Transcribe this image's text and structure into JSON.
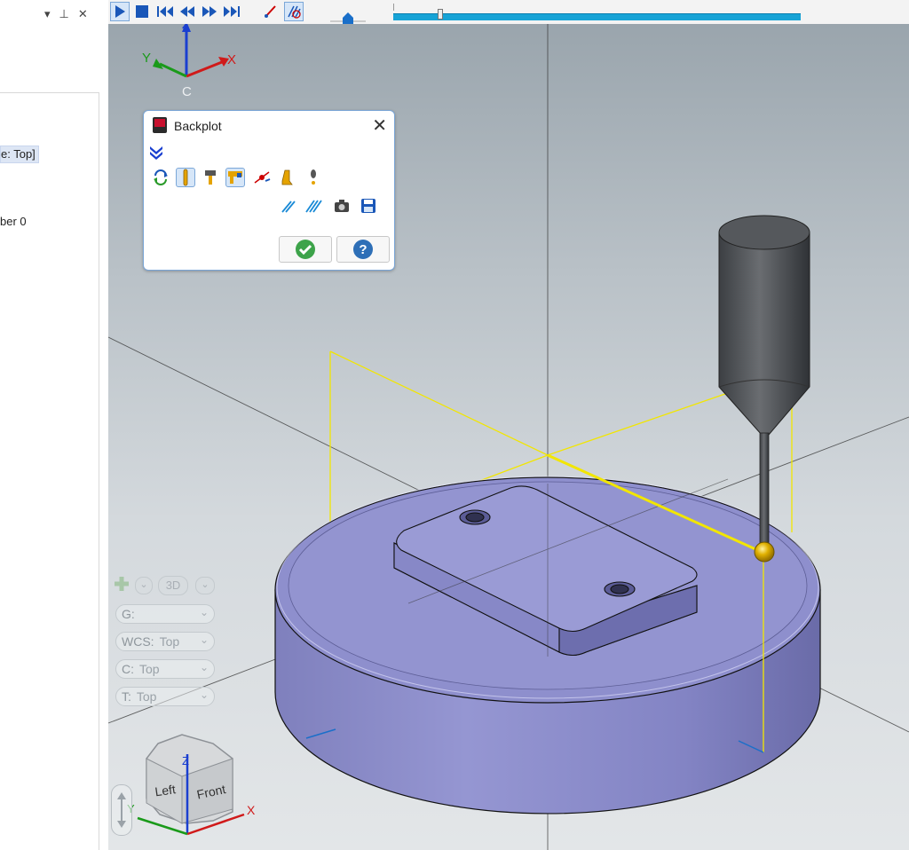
{
  "left_panel": {
    "tree_selected_text": "e: Top]",
    "tree_text": "ber 0"
  },
  "toolbar": {
    "buttons": [
      "play-icon",
      "stop-icon",
      "step-first-icon",
      "step-back-icon",
      "step-forward-icon",
      "step-last-icon",
      "toolpath-icon",
      "display-mode-icon"
    ],
    "progress_fraction": 0.11
  },
  "backplot": {
    "title": "Backplot",
    "ok_label": "✔",
    "help_label": "?"
  },
  "gnomon": {
    "x": "X",
    "y": "Y",
    "z": "Z",
    "c": "C"
  },
  "view_controls": {
    "mode": "3D",
    "g_label": "G:",
    "g_value": "",
    "wcs_label": "WCS:",
    "wcs_value": "Top",
    "c_label": "C:",
    "c_value": "Top",
    "t_label": "T:",
    "t_value": "Top"
  },
  "view_cube": {
    "left": "Left",
    "front": "Front",
    "z": "Z",
    "x": "X",
    "y": "Y"
  },
  "colors": {
    "accent": "#17a3d6",
    "toolpath": "#f2e600",
    "part": "#8e8fcd",
    "tool": "#4a4d51"
  }
}
